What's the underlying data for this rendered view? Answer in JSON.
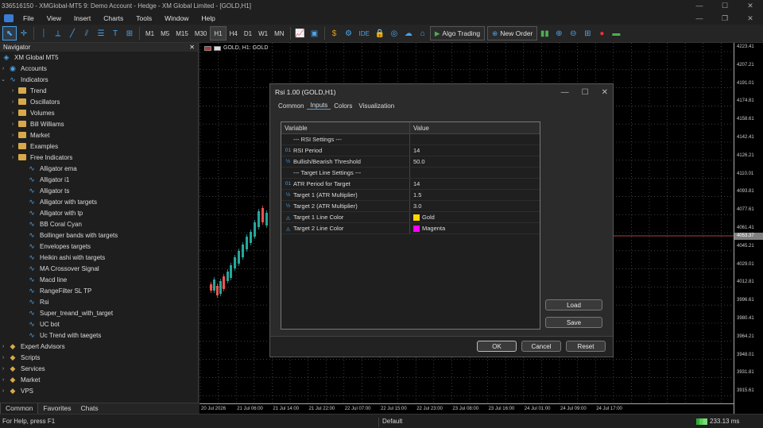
{
  "window": {
    "title": "336516150 - XMGlobal-MT5 9: Demo Account - Hedge - XM Global Limited - [GOLD,H1]"
  },
  "menu": [
    "File",
    "View",
    "Insert",
    "Charts",
    "Tools",
    "Window",
    "Help"
  ],
  "toolbar": {
    "timeframes": [
      "M1",
      "M5",
      "M15",
      "M30",
      "H1",
      "H4",
      "D1",
      "W1",
      "MN"
    ],
    "selected_timeframe": "H1",
    "ide_label": "IDE",
    "algo_label": "Algo Trading",
    "new_order_label": "New Order"
  },
  "navigator": {
    "title": "Navigator",
    "root": "XM Global MT5",
    "accounts": "Accounts",
    "indicators": "Indicators",
    "indicator_folders": [
      "Trend",
      "Oscillators",
      "Volumes",
      "Bill Williams",
      "Market",
      "Examples",
      "Free Indicators"
    ],
    "indicator_items": [
      "Alligator ema",
      "Alligator i1",
      "Alligator ts",
      "Alligator with targets",
      "Alligator with tp",
      "BB Coral Cyan",
      "Bollinger bands with targets",
      "Envelopes targets",
      "Heikin ashi with targets",
      "MA Crossover Signal",
      "Macd line",
      "RangeFilter SL TP",
      "Rsi",
      "Super_treand_with_target",
      "UC bot",
      "Uc Trend with taegets"
    ],
    "bottom_items": [
      "Expert Advisors",
      "Scripts",
      "Services",
      "Market",
      "VPS"
    ],
    "tabs": [
      "Common",
      "Favorites",
      "Chats"
    ]
  },
  "chart": {
    "symbol_label": "GOLD, H1: GOLD",
    "prices": [
      "4223.41",
      "4207.21",
      "4191.01",
      "4174.81",
      "4158.61",
      "4142.41",
      "4126.21",
      "4110.01",
      "4093.81",
      "4077.61",
      "4061.41",
      "4045.21",
      "4029.01",
      "4012.81",
      "3996.61",
      "3980.41",
      "3964.21",
      "3948.01",
      "3931.81",
      "3915.61"
    ],
    "current_price": "4053.37",
    "times": [
      "20 Jul 2026",
      "21 Jul 06:00",
      "21 Jul 14:00",
      "21 Jul 22:00",
      "22 Jul 07:00",
      "22 Jul 15:00",
      "22 Jul 23:00",
      "23 Jul 08:00",
      "23 Jul 16:00",
      "24 Jul 01:00",
      "24 Jul 09:00",
      "24 Jul 17:00"
    ]
  },
  "dialog": {
    "title": "Rsi 1.00 (GOLD,H1)",
    "tabs": [
      "Common",
      "Inputs",
      "Colors",
      "Visualization"
    ],
    "active_tab": "Inputs",
    "columns": {
      "variable": "Variable",
      "value": "Value"
    },
    "rows": [
      {
        "icon": "",
        "variable": "--- RSI Settings ---",
        "value": ""
      },
      {
        "icon": "01",
        "variable": "RSI Period",
        "value": "14"
      },
      {
        "icon": "½",
        "variable": "Bullish/Bearish Threshold",
        "value": "50.0"
      },
      {
        "icon": "",
        "variable": "--- Target Line Settings ---",
        "value": ""
      },
      {
        "icon": "01",
        "variable": "ATR Period for Target",
        "value": "14"
      },
      {
        "icon": "½",
        "variable": "Target 1 (ATR Multiplier)",
        "value": "1.5"
      },
      {
        "icon": "½",
        "variable": "Target 2 (ATR Multiplier)",
        "value": "3.0"
      },
      {
        "icon": "◬",
        "variable": "Target 1 Line Color",
        "value": "Gold",
        "color": "#ffd700"
      },
      {
        "icon": "◬",
        "variable": "Target 2 Line Color",
        "value": "Magenta",
        "color": "#ff00ff"
      }
    ],
    "load_label": "Load",
    "save_label": "Save",
    "ok_label": "OK",
    "cancel_label": "Cancel",
    "reset_label": "Reset"
  },
  "status": {
    "help": "For Help, press F1",
    "profile": "Default",
    "ping": "233.13 ms"
  }
}
